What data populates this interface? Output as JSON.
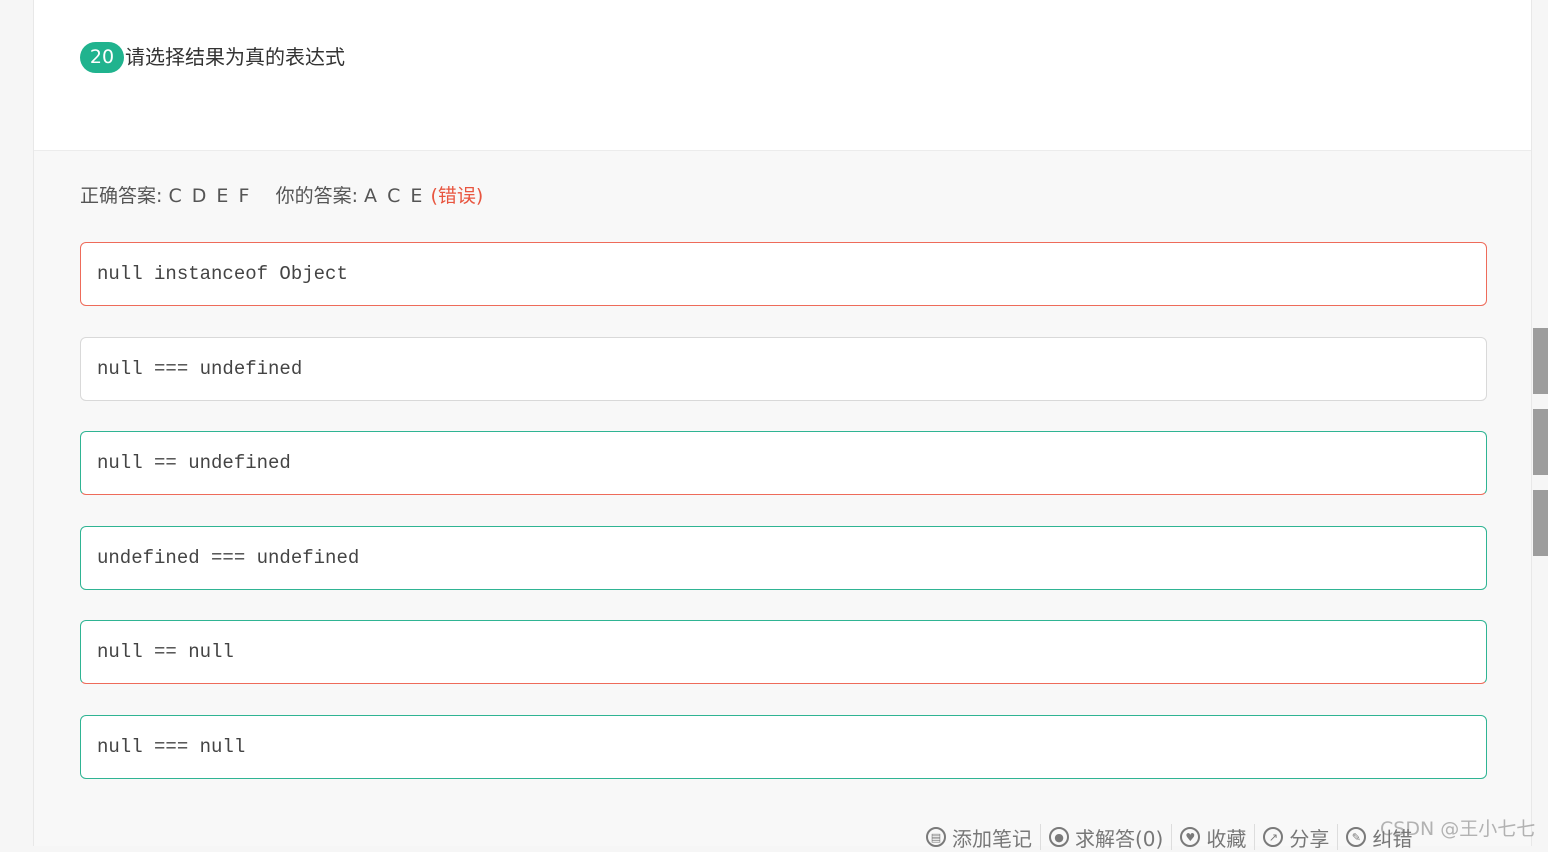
{
  "question": {
    "number": "20",
    "text": "请选择结果为真的表达式"
  },
  "answer": {
    "correct_label": "正确答案:",
    "correct_value": "C D E F",
    "yours_label": "你的答案:",
    "yours_value": "A C E",
    "status": "(错误)"
  },
  "options": [
    {
      "text": "null instanceof Object"
    },
    {
      "text": "null === undefined"
    },
    {
      "text": "null == undefined"
    },
    {
      "text": "undefined === undefined"
    },
    {
      "text": "null == null"
    },
    {
      "text": "null === null"
    }
  ],
  "actions": [
    {
      "label": "添加笔记",
      "icon": "book-icon"
    },
    {
      "label": "求解答(0)",
      "icon": "chat-bubble-icon"
    },
    {
      "label": "收藏",
      "icon": "heart-icon"
    },
    {
      "label": "分享",
      "icon": "share-icon"
    },
    {
      "label": "纠错",
      "icon": "edit-icon"
    }
  ],
  "watermark": "CSDN @王小七七",
  "colors": {
    "accent": "#20b38e",
    "correct_border": "#2fb493",
    "wrong_border": "#ee6b5a",
    "wrong_text": "#e8553f"
  }
}
